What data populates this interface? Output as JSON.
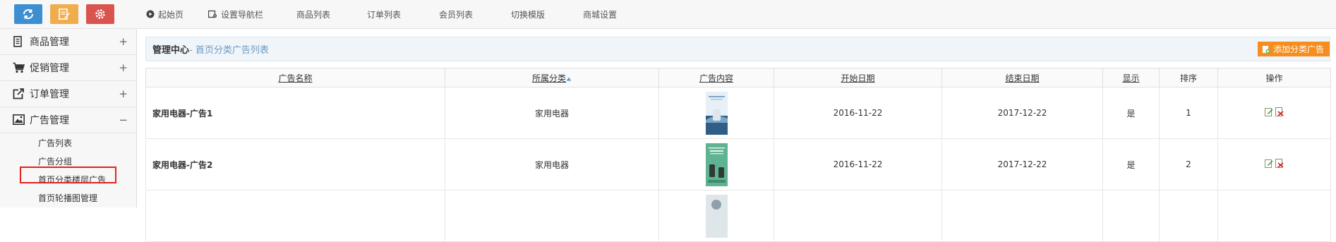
{
  "quick_buttons": [
    {
      "icon": "refresh-icon",
      "color": "#3d8fd1"
    },
    {
      "icon": "edit-note-icon",
      "color": "#f0ad4e"
    },
    {
      "icon": "settings-icon",
      "color": "#d9534f"
    }
  ],
  "topnav": [
    {
      "label": "起始页",
      "icon": "play-circle-icon"
    },
    {
      "label": "设置导航栏",
      "icon": "settings-nav-icon"
    },
    {
      "label": "商品列表"
    },
    {
      "label": "订单列表"
    },
    {
      "label": "会员列表"
    },
    {
      "label": "切换模版"
    },
    {
      "label": "商城设置"
    }
  ],
  "sidebar": {
    "groups": [
      {
        "label": "商品管理",
        "icon": "document-icon",
        "toggle": "+"
      },
      {
        "label": "促销管理",
        "icon": "cart-icon",
        "toggle": "+"
      },
      {
        "label": "订单管理",
        "icon": "share-box-icon",
        "toggle": "+"
      },
      {
        "label": "广告管理",
        "icon": "image-icon",
        "toggle": "−"
      }
    ],
    "ad_items": [
      "广告列表",
      "广告分组",
      "首页分类楼层广告",
      "首页轮播图管理"
    ]
  },
  "header": {
    "title": "管理中心",
    "subtitle": "- 首页分类广告列表",
    "add_button": "添加分类广告"
  },
  "table": {
    "columns": [
      "广告名称",
      "所属分类",
      "广告内容",
      "开始日期",
      "结束日期",
      "显示",
      "排序",
      "操作"
    ],
    "rows": [
      {
        "name": "家用电器-广告1",
        "category": "家用电器",
        "start": "2016-11-22",
        "end": "2017-12-22",
        "show": "是",
        "sort": "1"
      },
      {
        "name": "家用电器-广告2",
        "category": "家用电器",
        "start": "2016-11-22",
        "end": "2017-12-22",
        "show": "是",
        "sort": "2"
      }
    ]
  },
  "colors": {
    "accent_orange": "#f58d1f",
    "highlight_red": "#e4231d",
    "link_blue": "#6a9ac4"
  }
}
